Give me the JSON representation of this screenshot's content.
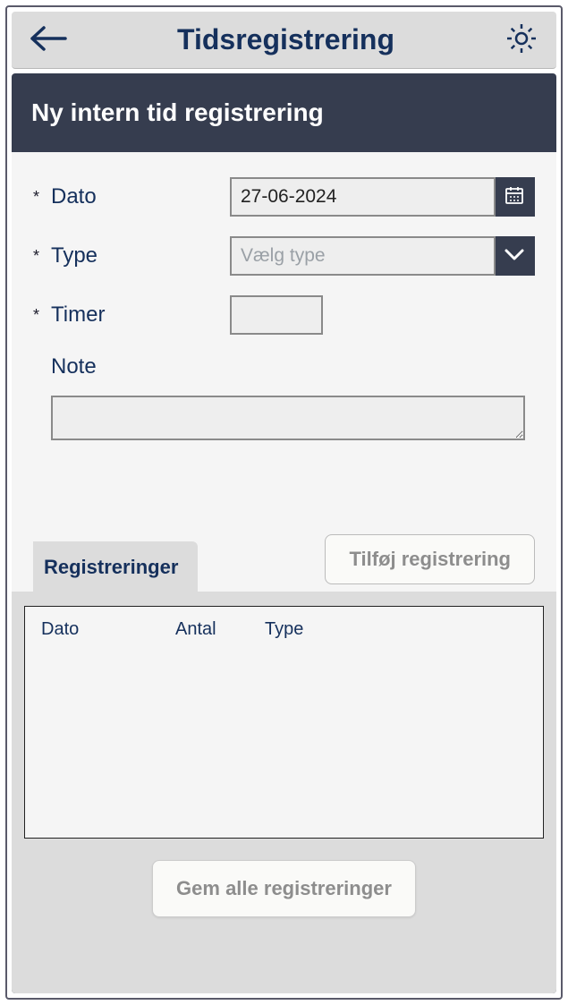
{
  "header": {
    "title": "Tidsregistrering"
  },
  "page": {
    "heading": "Ny intern tid registrering"
  },
  "form": {
    "required_mark": "*",
    "date": {
      "label": "Dato",
      "value": "27-06-2024"
    },
    "type": {
      "label": "Type",
      "placeholder": "Vælg type",
      "value": ""
    },
    "hours": {
      "label": "Timer",
      "value": ""
    },
    "note": {
      "label": "Note",
      "value": ""
    }
  },
  "tabs": {
    "registrations_label": "Registreringer"
  },
  "buttons": {
    "add_registration": "Tilføj registrering",
    "save_all": "Gem alle registreringer"
  },
  "table": {
    "columns": {
      "date": "Dato",
      "count": "Antal",
      "type": "Type"
    },
    "rows": []
  },
  "icons": {
    "back": "back-arrow-icon",
    "settings": "gear-icon",
    "calendar": "calendar-icon",
    "dropdown": "chevron-down-icon"
  }
}
